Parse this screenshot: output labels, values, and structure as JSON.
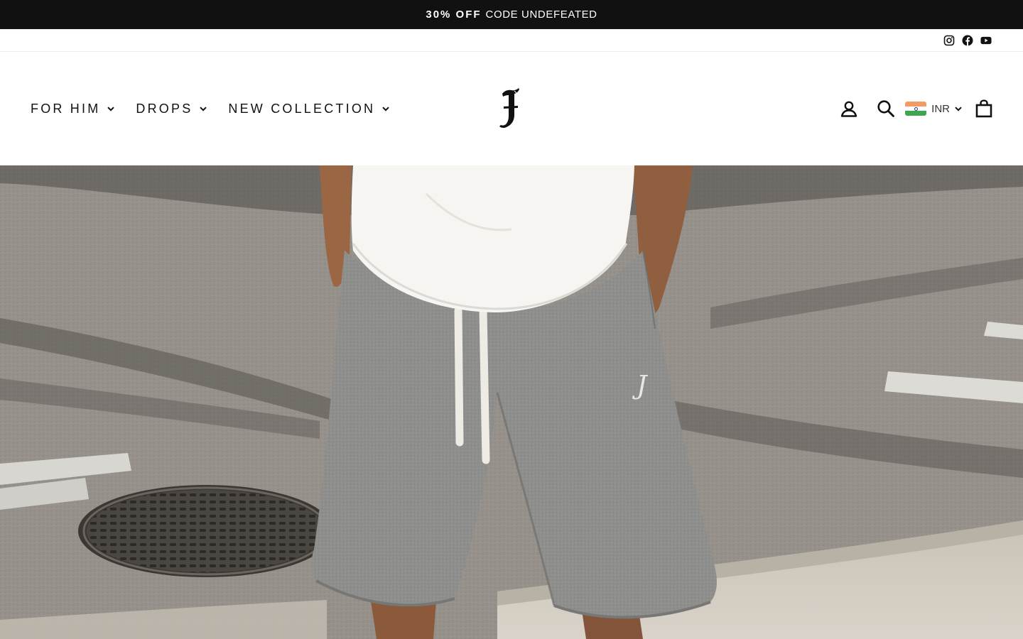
{
  "announcement": {
    "bold": "30% OFF",
    "text": "CODE UNDEFEATED"
  },
  "social": [
    {
      "name": "instagram-icon"
    },
    {
      "name": "facebook-icon"
    },
    {
      "name": "youtube-icon"
    }
  ],
  "nav": {
    "items": [
      {
        "label": "FOR HIM"
      },
      {
        "label": "DROPS"
      },
      {
        "label": "NEW COLLECTION"
      }
    ]
  },
  "logo": {
    "glyph": "J"
  },
  "tools": {
    "currency_code": "INR",
    "flag": "india-flag"
  },
  "hero": {
    "alt_subject": "man-in-grey-sweat-shorts-and-white-tee",
    "shorts_logo_glyph": "J"
  },
  "colors": {
    "announcement_bg": "#111111",
    "text": "#111111",
    "shorts": "#8e8e8c",
    "asphalt": "#8f8a82"
  }
}
